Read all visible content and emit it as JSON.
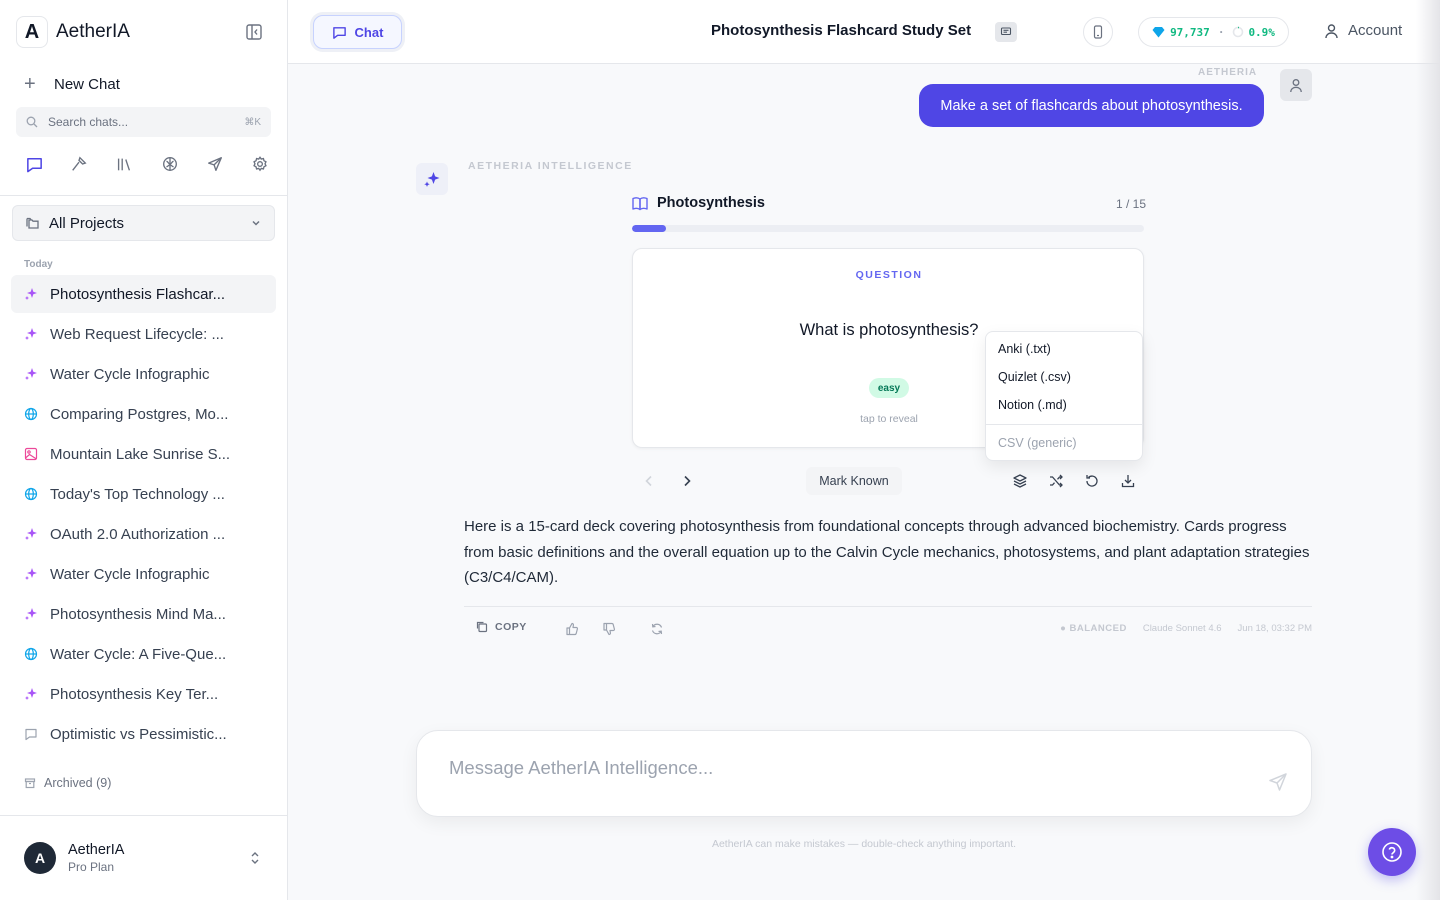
{
  "brand": {
    "logo_letter": "A",
    "name": "AetherIA"
  },
  "sidebar": {
    "new_chat": "New Chat",
    "search": {
      "placeholder": "Search chats...",
      "shortcut": "⌘K"
    },
    "projects_label": "All Projects",
    "section_today": "Today",
    "history": [
      {
        "label": "Photosynthesis Flashcar...",
        "icon": "sparkle-icon",
        "active": true
      },
      {
        "label": "Web Request Lifecycle: ...",
        "icon": "sparkle-icon"
      },
      {
        "label": "Water Cycle Infographic",
        "icon": "sparkle-icon"
      },
      {
        "label": "Comparing Postgres, Mo...",
        "icon": "globe-icon"
      },
      {
        "label": "Mountain Lake Sunrise S...",
        "icon": "image-icon"
      },
      {
        "label": "Today's Top Technology ...",
        "icon": "globe-icon"
      },
      {
        "label": "OAuth 2.0 Authorization ...",
        "icon": "sparkle-icon"
      },
      {
        "label": "Water Cycle Infographic",
        "icon": "sparkle-icon"
      },
      {
        "label": "Photosynthesis Mind Ma...",
        "icon": "sparkle-icon"
      },
      {
        "label": "Water Cycle: A Five-Que...",
        "icon": "globe-icon"
      },
      {
        "label": "Photosynthesis Key Ter...",
        "icon": "sparkle-icon"
      },
      {
        "label": "Optimistic vs Pessimistic...",
        "icon": "chat-icon"
      }
    ],
    "archived": "Archived (9)",
    "user": {
      "initial": "A",
      "name": "AetherIA",
      "plan": "Pro Plan"
    }
  },
  "header": {
    "chat_tab": "Chat",
    "title": "Photosynthesis Flashcard Study Set",
    "credits": "97,737",
    "usage": "0.9%",
    "account": "Account"
  },
  "conversation": {
    "user_label": "AETHERIA",
    "user_message": "Make a set of flashcards about photosynthesis.",
    "ai_label": "AETHERIA INTELLIGENCE",
    "flashcards": {
      "title": "Photosynthesis",
      "counter": "1 / 15",
      "progress": 0.067,
      "card_label": "QUESTION",
      "question": "What is photosynthesis?",
      "difficulty": "easy",
      "hint": "tap to reveal",
      "mark_known": "Mark Known",
      "export_options": [
        "Anki (.txt)",
        "Quizlet (.csv)",
        "Notion (.md)"
      ],
      "export_more": "CSV (generic)"
    },
    "answer": "Here is a 15-card deck covering photosynthesis from foundational concepts through advanced biochemistry. Cards progress from basic definitions and the overall equation up to the Calvin Cycle mechanics, photosystems, and plant adaptation strategies (C3/C4/CAM).",
    "actions": {
      "copy": "COPY"
    },
    "meta": {
      "mode": "● BALANCED",
      "model": "Claude Sonnet 4.6",
      "time": "Jun 18, 03:32 PM"
    }
  },
  "composer": {
    "placeholder": "Message AetherIA Intelligence...",
    "disclaimer": "AetherIA can make mistakes — double-check anything important."
  },
  "colors": {
    "accent": "#4f46e5",
    "accent_light": "#6366f1",
    "easy_bg": "#d1fae5",
    "help": "#6d4de6"
  }
}
